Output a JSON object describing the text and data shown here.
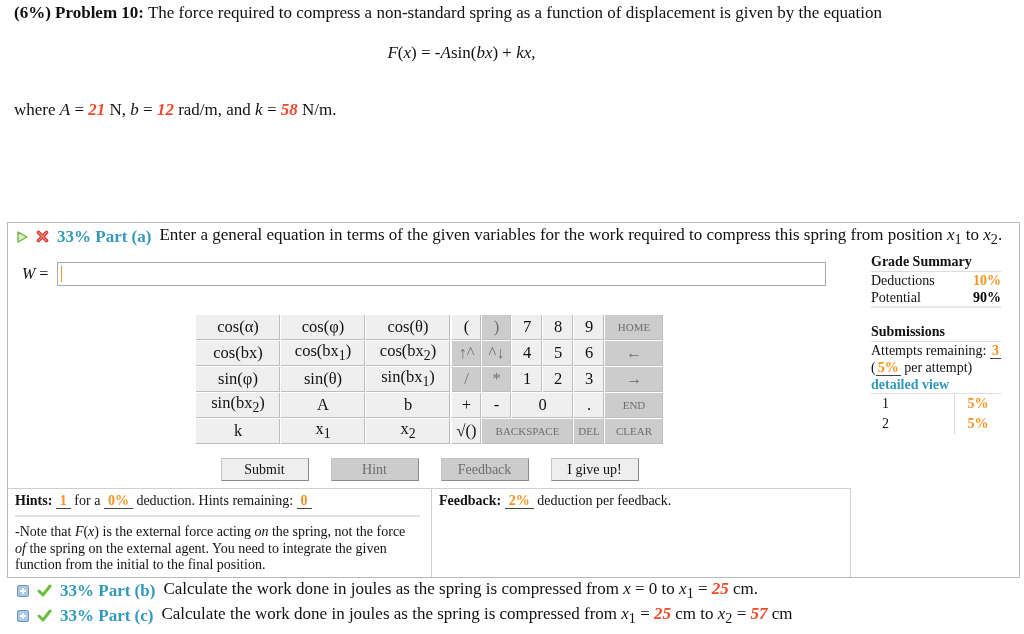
{
  "problem": {
    "heading": "(6%) Problem 10:",
    "statement": "The force required to compress a non-standard spring as a function of displacement is given by the equation",
    "equation": [
      {
        "kind": "text",
        "text": "*F*(*x*) = -"
      },
      {
        "kind": "text",
        "text": "*A*"
      },
      {
        "kind": "text",
        "text": "sin(*bx*) + *kx*,"
      }
    ],
    "given": [
      {
        "kind": "text",
        "text": "where *A* = "
      },
      {
        "kind": "value",
        "text": "21"
      },
      {
        "kind": "text",
        "text": " N, *b* = "
      },
      {
        "kind": "value",
        "text": "12"
      },
      {
        "kind": "text",
        "text": " rad/m, and *k* = "
      },
      {
        "kind": "value",
        "text": "58"
      },
      {
        "kind": "text",
        "text": " N/m."
      }
    ]
  },
  "parts": [
    {
      "title": "33% Part (a)",
      "correct": false,
      "expanded": true,
      "prompt": [
        {
          "kind": "text",
          "text": "Enter a general equation in terms of the given variables for the work required to compress this spring from position *x*$_{1}$ to *x*$_{2}$."
        }
      ],
      "answer": {
        "label": "*W* =",
        "focused": true
      },
      "keypad": {
        "rows": [
          {
            "functions": [
              "cos(α)",
              "cos(φ)",
              "cos(θ)"
            ],
            "keys": [
              {
                "label": "(",
                "kind": "symbol",
                "disabled": false,
                "wide": false
              },
              {
                "label": ")",
                "kind": "symbol",
                "disabled": true,
                "wide": false
              },
              {
                "label": "7",
                "kind": "symbol",
                "disabled": false,
                "wide": false
              },
              {
                "label": "8",
                "kind": "symbol",
                "disabled": false,
                "wide": false
              },
              {
                "label": "9",
                "kind": "symbol",
                "disabled": false,
                "wide": false
              },
              {
                "label": "HOME",
                "kind": "command",
                "disabled": true,
                "wide": false
              }
            ]
          },
          {
            "functions": [
              "cos(bx)",
              "cos(bx$_{1}$)",
              "cos(bx$_{2}$)"
            ],
            "keys": [
              {
                "label": "↑^",
                "kind": "symbol",
                "disabled": true,
                "wide": false
              },
              {
                "label": "^↓",
                "kind": "symbol",
                "disabled": true,
                "wide": false
              },
              {
                "label": "4",
                "kind": "symbol",
                "disabled": false,
                "wide": false
              },
              {
                "label": "5",
                "kind": "symbol",
                "disabled": false,
                "wide": false
              },
              {
                "label": "6",
                "kind": "symbol",
                "disabled": false,
                "wide": false
              },
              {
                "label": "←",
                "kind": "symbol",
                "disabled": true,
                "wide": false
              }
            ]
          },
          {
            "functions": [
              "sin(φ)",
              "sin(θ)",
              "sin(bx$_{1}$)"
            ],
            "keys": [
              {
                "label": "/",
                "kind": "symbol",
                "disabled": true,
                "wide": false
              },
              {
                "label": "*",
                "kind": "symbol",
                "disabled": true,
                "wide": false
              },
              {
                "label": "1",
                "kind": "symbol",
                "disabled": false,
                "wide": false
              },
              {
                "label": "2",
                "kind": "symbol",
                "disabled": false,
                "wide": false
              },
              {
                "label": "3",
                "kind": "symbol",
                "disabled": false,
                "wide": false
              },
              {
                "label": "→",
                "kind": "symbol",
                "disabled": true,
                "wide": false
              }
            ]
          },
          {
            "functions": [
              "sin(bx$_{2}$)",
              "A",
              "b"
            ],
            "keys": [
              {
                "label": "+",
                "kind": "symbol",
                "disabled": false,
                "wide": false
              },
              {
                "label": "-",
                "kind": "symbol",
                "disabled": false,
                "wide": false
              },
              {
                "label": "0",
                "kind": "symbol",
                "disabled": false,
                "wide": true
              },
              {
                "label": ".",
                "kind": "symbol",
                "disabled": false,
                "wide": false
              },
              {
                "label": "END",
                "kind": "command",
                "disabled": true,
                "wide": false
              }
            ]
          },
          {
            "functions": [
              "k",
              "x$_{1}$",
              "x$_{2}$"
            ],
            "keys": [
              {
                "label": "√()",
                "kind": "symbol",
                "disabled": false,
                "wide": false
              },
              {
                "label": "BACKSPACE",
                "kind": "command",
                "disabled": true,
                "wide": true
              },
              {
                "label": "DEL",
                "kind": "command",
                "disabled": true,
                "wide": false
              },
              {
                "label": "CLEAR",
                "kind": "command",
                "disabled": true,
                "wide": false
              }
            ]
          }
        ]
      },
      "buttons": [
        {
          "label": "Submit",
          "disabled": false
        },
        {
          "label": "Hint",
          "disabled": true
        },
        {
          "label": "Feedback",
          "disabled": true
        },
        {
          "label": "I give up!",
          "disabled": false
        }
      ],
      "hints": {
        "title": "Hints:",
        "summary": [
          {
            "kind": "score",
            "text": "1"
          },
          {
            "kind": "text",
            "text": " for a "
          },
          {
            "kind": "score",
            "text": "0%"
          },
          {
            "kind": "text",
            "text": " deduction. Hints remaining: "
          },
          {
            "kind": "score",
            "text": "0"
          }
        ],
        "note": "-Note that *F*(*x*) is the external force acting *on* the spring, not the force *of* the spring on the external agent. You need to integrate the given function from the initial to the final position."
      },
      "feedback": {
        "title": "Feedback:",
        "summary": [
          {
            "kind": "score",
            "text": "2%"
          },
          {
            "kind": "text",
            "text": " deduction per feedback."
          }
        ]
      },
      "grade_summary": {
        "title": "Grade Summary",
        "rows": [
          {
            "label": "Deductions",
            "value": "10%",
            "color": "#f7931e"
          },
          {
            "label": "Potential",
            "value": "90%",
            "color": "#000000"
          }
        ]
      },
      "submissions": {
        "title": "Submissions",
        "attempts": [
          {
            "kind": "text",
            "text": "Attempts remaining: "
          },
          {
            "kind": "score",
            "text": "3"
          },
          {
            "kind": "text",
            "text": " ("
          },
          {
            "kind": "score",
            "text": "5%"
          },
          {
            "kind": "text",
            "text": " per attempt)"
          }
        ],
        "link": "detailed view",
        "history": [
          {
            "number": "1",
            "deduction": "5%"
          },
          {
            "number": "2",
            "deduction": "5%"
          }
        ]
      }
    },
    {
      "title": "33% Part (b)",
      "correct": true,
      "expanded": false,
      "prompt": [
        {
          "kind": "text",
          "text": "Calculate the work done in joules as the spring is compressed from *x* = 0 to *x*$_{1}$ = "
        },
        {
          "kind": "value",
          "text": "25"
        },
        {
          "kind": "text",
          "text": " cm."
        }
      ]
    },
    {
      "title": "33% Part (c)",
      "correct": true,
      "expanded": false,
      "prompt": [
        {
          "kind": "text",
          "text": "Calculate the work done in joules as the spring is compressed from *x*$_{1}$ = "
        },
        {
          "kind": "value",
          "text": "25"
        },
        {
          "kind": "text",
          "text": " cm to *x*$_{2}$ = "
        },
        {
          "kind": "value",
          "text": "57"
        },
        {
          "kind": "text",
          "text": " cm"
        }
      ]
    }
  ]
}
